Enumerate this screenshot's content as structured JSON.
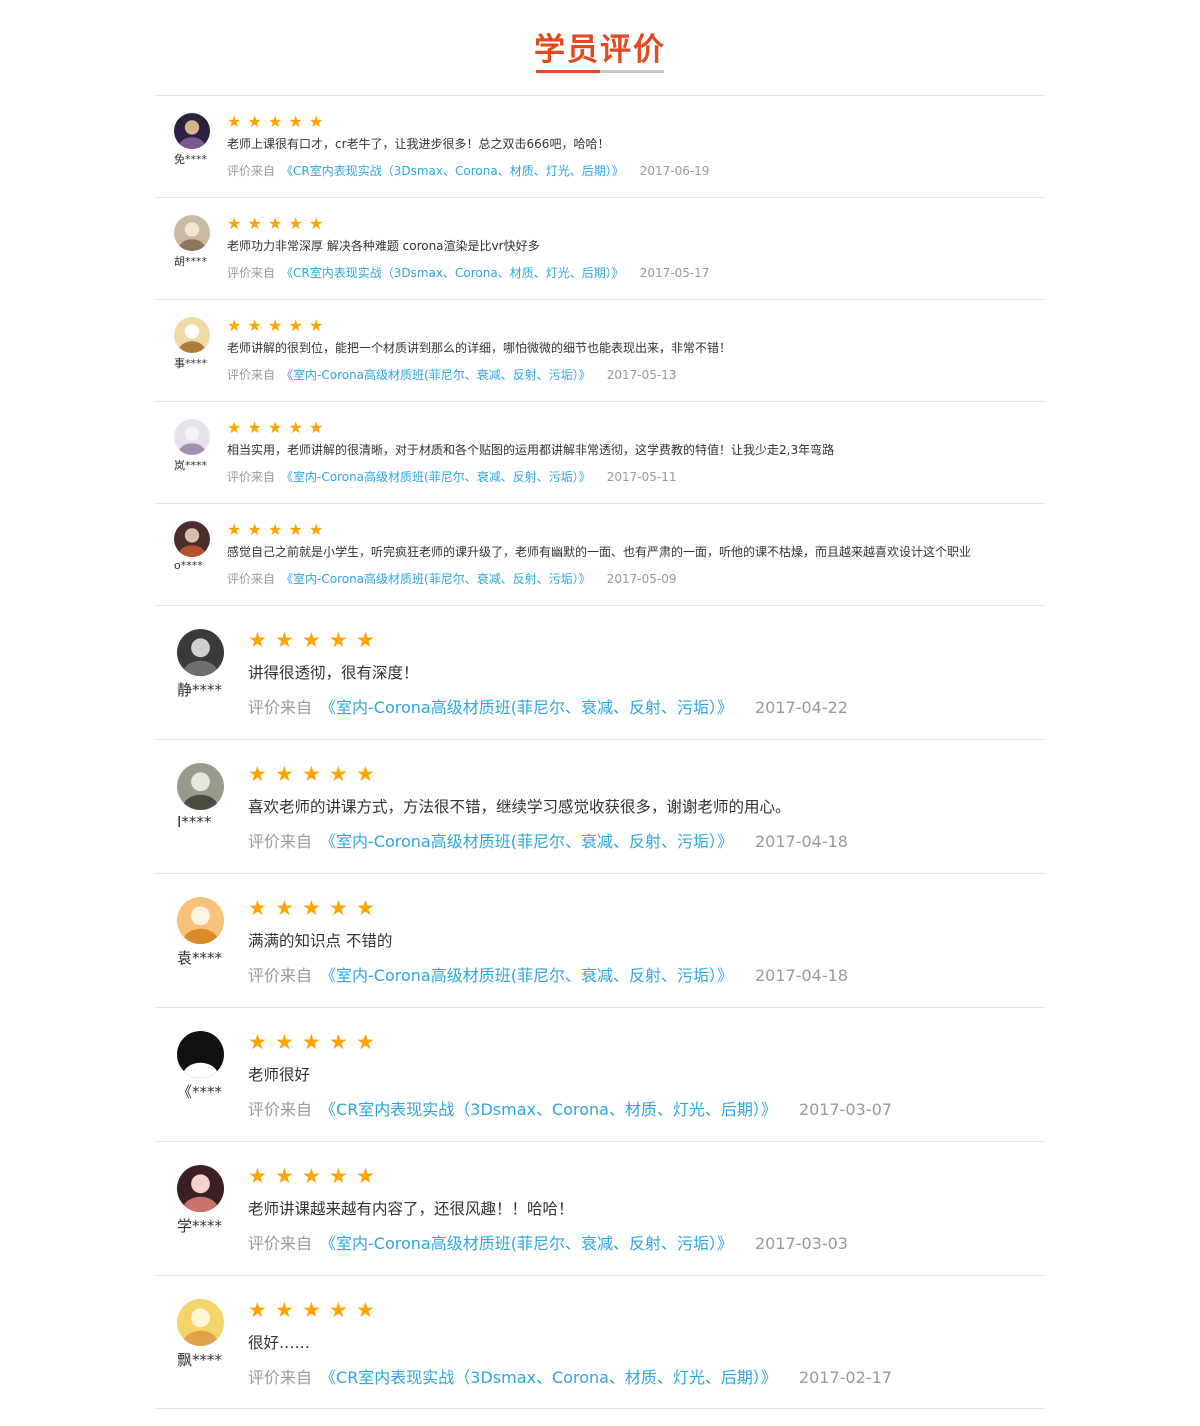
{
  "section_title": "学员评价",
  "colors": {
    "accent": "#e2491c",
    "star": "#ffa300",
    "link": "#2ea7e0",
    "muted": "#999999",
    "divider": "#e4e4e4"
  },
  "source_label": "评价来自",
  "star_glyph": "★",
  "reviews": [
    {
      "user": "免****",
      "rating": 5,
      "text": "老师上课很有口才，cr老牛了，让我进步很多！总之双击666吧，哈哈！",
      "course": "《CR室内表现实战（3Dsmax、Corona、材质、灯光、后期）》",
      "date": "2017-06-19",
      "avatar_icon": "user-avatar-icon"
    },
    {
      "user": "胡****",
      "rating": 5,
      "text": "老师功力非常深厚 解决各种难题 corona渲染是比vr快好多",
      "course": "《CR室内表现实战（3Dsmax、Corona、材质、灯光、后期）》",
      "date": "2017-05-17",
      "avatar_icon": "user-avatar-icon"
    },
    {
      "user": "事****",
      "rating": 5,
      "text": "老师讲解的很到位，能把一个材质讲到那么的详细，哪怕微微的细节也能表现出来，非常不错！",
      "course": "《室内-Corona高级材质班(菲尼尔、衰减、反射、污垢）》",
      "date": "2017-05-13",
      "avatar_icon": "user-avatar-icon"
    },
    {
      "user": "岚****",
      "rating": 5,
      "text": "相当实用，老师讲解的很清晰，对于材质和各个贴图的运用都讲解非常透彻，这学费教的特值！让我少走2,3年弯路",
      "course": "《室内-Corona高级材质班(菲尼尔、衰减、反射、污垢）》",
      "date": "2017-05-11",
      "avatar_icon": "user-avatar-icon"
    },
    {
      "user": "o****",
      "rating": 5,
      "text": "感觉自己之前就是小学生，听完疯狂老师的课升级了，老师有幽默的一面、也有严肃的一面，听他的课不枯燥，而且越来越喜欢设计这个职业",
      "course": "《室内-Corona高级材质班(菲尼尔、衰减、反射、污垢）》",
      "date": "2017-05-09",
      "avatar_icon": "user-avatar-icon"
    },
    {
      "user": "静****",
      "rating": 5,
      "text": "讲得很透彻，很有深度！",
      "course": "《室内-Corona高级材质班(菲尼尔、衰减、反射、污垢）》",
      "date": "2017-04-22",
      "avatar_icon": "user-avatar-icon"
    },
    {
      "user": "I****",
      "rating": 5,
      "text": "喜欢老师的讲课方式，方法很不错，继续学习感觉收获很多，谢谢老师的用心。",
      "course": "《室内-Corona高级材质班(菲尼尔、衰减、反射、污垢）》",
      "date": "2017-04-18",
      "avatar_icon": "user-avatar-icon"
    },
    {
      "user": "袁****",
      "rating": 5,
      "text": "满满的知识点 不错的",
      "course": "《室内-Corona高级材质班(菲尼尔、衰减、反射、污垢）》",
      "date": "2017-04-18",
      "avatar_icon": "user-avatar-icon"
    },
    {
      "user": "《****",
      "rating": 5,
      "text": "老师很好",
      "course": "《CR室内表现实战（3Dsmax、Corona、材质、灯光、后期）》",
      "date": "2017-03-07",
      "avatar_icon": "user-avatar-icon"
    },
    {
      "user": "学****",
      "rating": 5,
      "text": "老师讲课越来越有内容了，还很风趣！！哈哈！",
      "course": "《室内-Corona高级材质班(菲尼尔、衰减、反射、污垢）》",
      "date": "2017-03-03",
      "avatar_icon": "user-avatar-icon"
    },
    {
      "user": "飘****",
      "rating": 5,
      "text": "很好……",
      "course": "《CR室内表现实战（3Dsmax、Corona、材质、灯光、后期）》",
      "date": "2017-02-17",
      "avatar_icon": "user-avatar-icon"
    }
  ]
}
